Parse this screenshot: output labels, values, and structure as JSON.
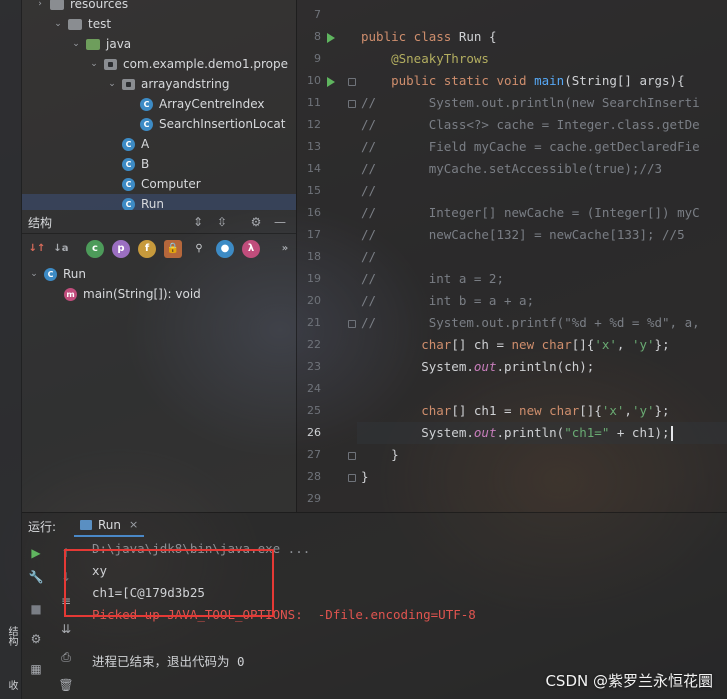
{
  "project_tree": [
    {
      "label": "resources",
      "icon": "folder",
      "color": "gray",
      "indent": 0,
      "chevron": "›"
    },
    {
      "label": "test",
      "icon": "folder",
      "color": "gray",
      "indent": 1,
      "chevron": "⌄"
    },
    {
      "label": "java",
      "icon": "folder",
      "color": "green",
      "indent": 2,
      "chevron": "⌄"
    },
    {
      "label": "com.example.demo1.prope",
      "icon": "package",
      "indent": 3,
      "chevron": "⌄"
    },
    {
      "label": "arrayandstring",
      "icon": "package",
      "indent": 4,
      "chevron": "⌄"
    },
    {
      "label": "ArrayCentreIndex",
      "icon": "class",
      "indent": 5,
      "chevron": ""
    },
    {
      "label": "SearchInsertionLocat",
      "icon": "class",
      "indent": 5,
      "chevron": ""
    },
    {
      "label": "A",
      "icon": "class",
      "indent": 4,
      "chevron": ""
    },
    {
      "label": "B",
      "icon": "class",
      "indent": 4,
      "chevron": ""
    },
    {
      "label": "Computer",
      "icon": "class",
      "indent": 4,
      "chevron": ""
    },
    {
      "label": "Run",
      "icon": "class",
      "indent": 4,
      "chevron": "",
      "selected": true
    }
  ],
  "structure": {
    "title": "结构",
    "tree": [
      {
        "label": "Run",
        "icon": "class"
      },
      {
        "label": "main(String[]): void",
        "icon": "method"
      }
    ]
  },
  "editor": {
    "line_numbers": [
      "7",
      "8",
      "9",
      "10",
      "11",
      "12",
      "13",
      "14",
      "15",
      "16",
      "17",
      "18",
      "19",
      "20",
      "21",
      "22",
      "23",
      "24",
      "25",
      "26",
      "27",
      "28",
      "29"
    ],
    "current_line": "26",
    "lines": [
      [],
      [
        {
          "t": "public class ",
          "c": "kw"
        },
        {
          "t": "Run {",
          "c": "plain"
        }
      ],
      [
        {
          "t": "    @SneakyThrows",
          "c": "ann"
        }
      ],
      [
        {
          "t": "    public static void ",
          "c": "kw"
        },
        {
          "t": "main",
          "c": "fn"
        },
        {
          "t": "(String[] args){",
          "c": "plain"
        }
      ],
      [
        {
          "t": "//       System.out.println(new SearchInserti",
          "c": "cmt"
        }
      ],
      [
        {
          "t": "//       Class<?> cache = Integer.class.getDe",
          "c": "cmt"
        }
      ],
      [
        {
          "t": "//       Field myCache = cache.getDeclaredFie",
          "c": "cmt"
        }
      ],
      [
        {
          "t": "//       myCache.setAccessible(true);//3",
          "c": "cmt"
        }
      ],
      [
        {
          "t": "//",
          "c": "cmt"
        }
      ],
      [
        {
          "t": "//       Integer[] newCache = (Integer[]) myC",
          "c": "cmt"
        }
      ],
      [
        {
          "t": "//       newCache[132] = newCache[133]; //5",
          "c": "cmt"
        }
      ],
      [
        {
          "t": "//",
          "c": "cmt"
        }
      ],
      [
        {
          "t": "//       int a = 2;",
          "c": "cmt"
        }
      ],
      [
        {
          "t": "//       int b = a + a;",
          "c": "cmt"
        }
      ],
      [
        {
          "t": "//       System.out.printf(\"%d + %d = %d\", a,",
          "c": "cmt"
        }
      ],
      [
        {
          "t": "        char",
          "c": "kw"
        },
        {
          "t": "[] ch = ",
          "c": "plain"
        },
        {
          "t": "new char",
          "c": "kw"
        },
        {
          "t": "[]{",
          "c": "plain"
        },
        {
          "t": "'x'",
          "c": "str"
        },
        {
          "t": ", ",
          "c": "plain"
        },
        {
          "t": "'y'",
          "c": "str"
        },
        {
          "t": "};",
          "c": "plain"
        }
      ],
      [
        {
          "t": "        System.",
          "c": "plain"
        },
        {
          "t": "out",
          "c": "fld"
        },
        {
          "t": ".println(ch);",
          "c": "plain"
        }
      ],
      [],
      [
        {
          "t": "        char",
          "c": "kw"
        },
        {
          "t": "[] ch1 = ",
          "c": "plain"
        },
        {
          "t": "new char",
          "c": "kw"
        },
        {
          "t": "[]{",
          "c": "plain"
        },
        {
          "t": "'x'",
          "c": "str"
        },
        {
          "t": ",",
          "c": "plain"
        },
        {
          "t": "'y'",
          "c": "str"
        },
        {
          "t": "};",
          "c": "plain"
        }
      ],
      [
        {
          "t": "        System.",
          "c": "plain"
        },
        {
          "t": "out",
          "c": "fld"
        },
        {
          "t": ".println(",
          "c": "plain"
        },
        {
          "t": "\"ch1=\"",
          "c": "str"
        },
        {
          "t": " + ch1);",
          "c": "plain"
        }
      ],
      [
        {
          "t": "    }",
          "c": "plain"
        }
      ],
      [
        {
          "t": "}",
          "c": "plain"
        }
      ],
      []
    ]
  },
  "run_panel": {
    "label": "运行:",
    "tab_label": "Run",
    "console_lines": [
      {
        "text": "D:\\java\\jdk8\\bin\\java.exe ...",
        "color": "#8c8f94"
      },
      {
        "text": "xy",
        "color": "#cfd1d4"
      },
      {
        "text": "ch1=[C@179d3b25",
        "color": "#cfd1d4"
      },
      {
        "text": "Picked up JAVA_TOOL_OPTIONS:  -Dfile.encoding=UTF-8",
        "color": "#e0544f"
      },
      {
        "text": "",
        "color": "#cfd1d4"
      },
      {
        "text": "进程已结束，退出代码为 0",
        "color": "#cfd1d4"
      }
    ]
  },
  "left_tabs": [
    "结构",
    "收"
  ],
  "watermark": "CSDN @紫罗兰永恒花圜",
  "colors": {
    "highlight_box": "#e53935",
    "run_icon": "#5fb55f"
  }
}
